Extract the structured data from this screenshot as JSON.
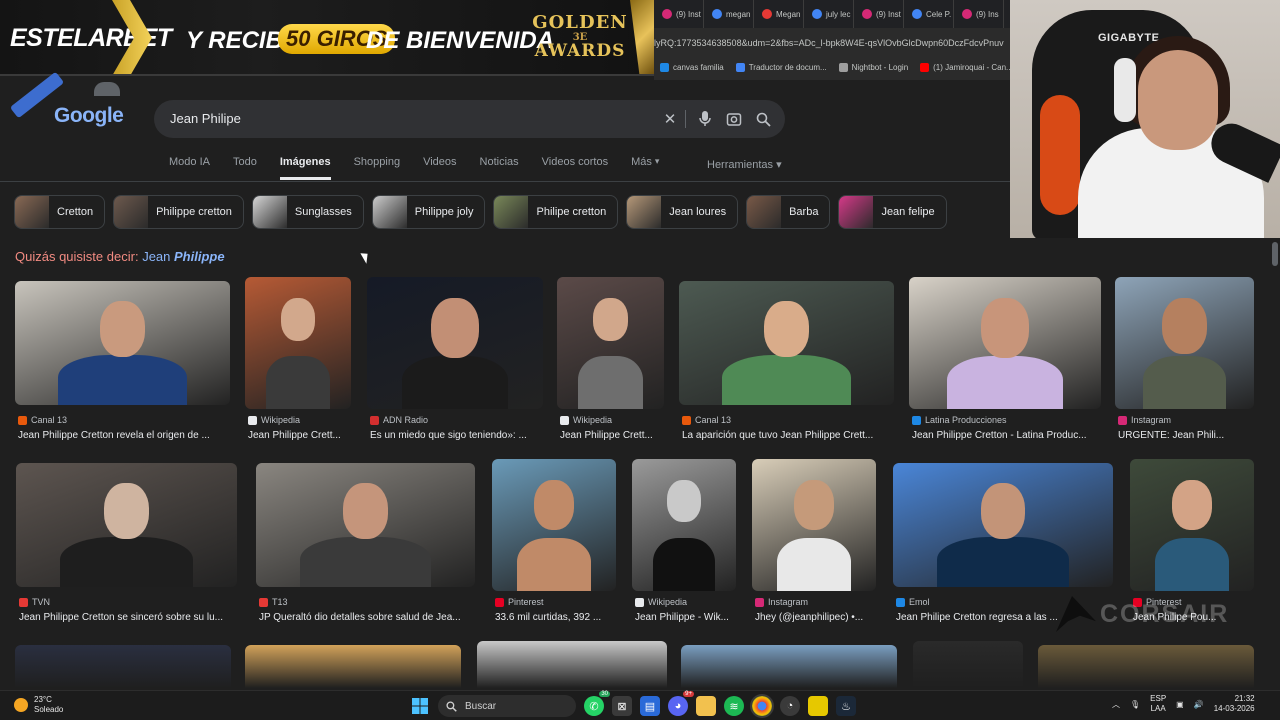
{
  "ad": {
    "brand": "ESTELARBET",
    "promo_pre": "Y RECIBE",
    "promo_pill": "50 GIROS",
    "promo_post": "DE BIENVENIDA",
    "award_line1": "GOLDEN",
    "award_line2": "3E",
    "award_line3": "AWARDS"
  },
  "browser": {
    "tabs": [
      {
        "label": "(9) Inst",
        "color": "#d62976"
      },
      {
        "label": "megan",
        "color": "#4285f4"
      },
      {
        "label": "Megan",
        "color": "#e53935"
      },
      {
        "label": "july lec",
        "color": "#4285f4"
      },
      {
        "label": "(9) Inst",
        "color": "#d62976"
      },
      {
        "label": "Cele P.",
        "color": "#4285f4"
      },
      {
        "label": "(9) Ins",
        "color": "#d62976"
      }
    ],
    "url": "lyRQ:1773534638508&udm=2&fbs=ADc_l-bpk8W4E-qsVlOvbGlcDwpn60DczFdcvPnuv",
    "bookmarks": [
      {
        "label": "canvas familia",
        "color": "#1e88e5"
      },
      {
        "label": "Traductor de docum...",
        "color": "#4285f4"
      },
      {
        "label": "Nightbot - Login",
        "color": "#9e9e9e"
      },
      {
        "label": "(1) Jamiroquai - Can...",
        "color": "#ff0000"
      }
    ]
  },
  "webcam": {
    "chair_brand": "GIGABYTE"
  },
  "google": {
    "logo": "Google",
    "query": "Jean Philipe",
    "nav_tabs": [
      "Modo IA",
      "Todo",
      "Imágenes",
      "Shopping",
      "Videos",
      "Noticias",
      "Videos cortos",
      "Más"
    ],
    "active_tab": "Imágenes",
    "tools": "Herramientas",
    "chips": [
      {
        "label": "Cretton",
        "color": "#8a6a55"
      },
      {
        "label": "Philippe cretton",
        "color": "#6e5a4e"
      },
      {
        "label": "Sunglasses",
        "color": "#d9d9d9"
      },
      {
        "label": "Philippe joly",
        "color": "#cfcfcf"
      },
      {
        "label": "Philipe cretton",
        "color": "#7b8a5a"
      },
      {
        "label": "Jean loures",
        "color": "#b89a7a"
      },
      {
        "label": "Barba",
        "color": "#7a5a48"
      },
      {
        "label": "Jean felipe",
        "color": "#d83a8a"
      }
    ],
    "suggest_prefix": "Quizás quisiste decir:",
    "suggest_plain": "Jean",
    "suggest_bold": "Philippe"
  },
  "results_row1": [
    {
      "source": "Canal 13",
      "title": "Jean Philippe Cretton revela el origen de ...",
      "fav": "#e8590c",
      "bg": "#c8c4bc",
      "suit": "#1f3f7a",
      "skin": "#c99a7e"
    },
    {
      "source": "Wikipedia",
      "title": "Jean Philippe Crett...",
      "fav": "#e8eaed",
      "bg": "#b65a35",
      "suit": "#3a3a3a",
      "skin": "#d2a88c"
    },
    {
      "source": "ADN Radio",
      "title": "Es un miedo que sigo teniendo»: ...",
      "fav": "#d32f2f",
      "bg": "#151a26",
      "suit": "#1b1b1b",
      "skin": "#c28f75"
    },
    {
      "source": "Wikipedia",
      "title": "Jean Philippe Crett...",
      "fav": "#e8eaed",
      "bg": "#5b4a48",
      "suit": "#6e6e6e",
      "skin": "#d1a78b"
    },
    {
      "source": "Canal 13",
      "title": "La aparición que tuvo Jean Philippe Crett...",
      "fav": "#e8590c",
      "bg": "#4d5a52",
      "suit": "#4f8a55",
      "skin": "#d9ac8a"
    },
    {
      "source": "Latina Producciones",
      "title": "Jean Philippe Cretton - Latina Produc...",
      "fav": "#1e88e5",
      "bg": "#d8d2c8",
      "suit": "#c9b3e0",
      "skin": "#c8957a"
    },
    {
      "source": "Instagram",
      "title": "URGENTE: Jean Phili...",
      "fav": "#d62976",
      "bg": "#8ea4b8",
      "suit": "#545c4c",
      "skin": "#b5805f"
    }
  ],
  "results_row2": [
    {
      "source": "TVN",
      "title": "Jean Philippe Cretton se sinceró sobre su lu...",
      "fav": "#e53935",
      "bg": "#5d5550",
      "suit": "#1e1e1e",
      "skin": "#cfb4a0"
    },
    {
      "source": "T13",
      "title": "JP Queraltó dio detalles sobre salud de Jea...",
      "fav": "#e53935",
      "bg": "#8a8680",
      "suit": "#3a3a3a",
      "skin": "#c5957b"
    },
    {
      "source": "Pinterest",
      "title": "33.6 mil curtidas, 392 ...",
      "fav": "#e60023",
      "bg": "#6a9ab8",
      "suit": "#c08a68",
      "skin": "#c08a68"
    },
    {
      "source": "Wikipedia",
      "title": "Jean Philippe - Wik...",
      "fav": "#e8eaed",
      "bg": "#9a9a9a",
      "suit": "#111111",
      "skin": "#c9c9c9"
    },
    {
      "source": "Instagram",
      "title": "Jhey (@jeanphilipec) •...",
      "fav": "#d62976",
      "bg": "#d8cdb8",
      "suit": "#e8e8e8",
      "skin": "#c59a7a"
    },
    {
      "source": "Emol",
      "title": "Jean Philipe Cretton regresa a las ...",
      "fav": "#1e88e5",
      "bg": "#4a86d8",
      "suit": "#0f2b4a",
      "skin": "#c39478"
    },
    {
      "source": "Pinterest",
      "title": "Jean Philipe Pou...",
      "fav": "#e60023",
      "bg": "#3e4a3a",
      "suit": "#2a5a7a",
      "skin": "#d3a386"
    }
  ],
  "results_row3_colors": [
    "#2a2f40",
    "#d2a25a",
    "#c8c8c8",
    "#7a9ec0",
    "#2a2a2a",
    "#6a5a3a"
  ],
  "watermark": "CORSAIR",
  "taskbar": {
    "temp": "23°C",
    "weather": "Soleado",
    "search": "Buscar",
    "lang1": "ESP",
    "lang2": "LAA",
    "time": "21:32",
    "date": "14-03-2026",
    "badge1": "30",
    "badge2": "9+"
  }
}
